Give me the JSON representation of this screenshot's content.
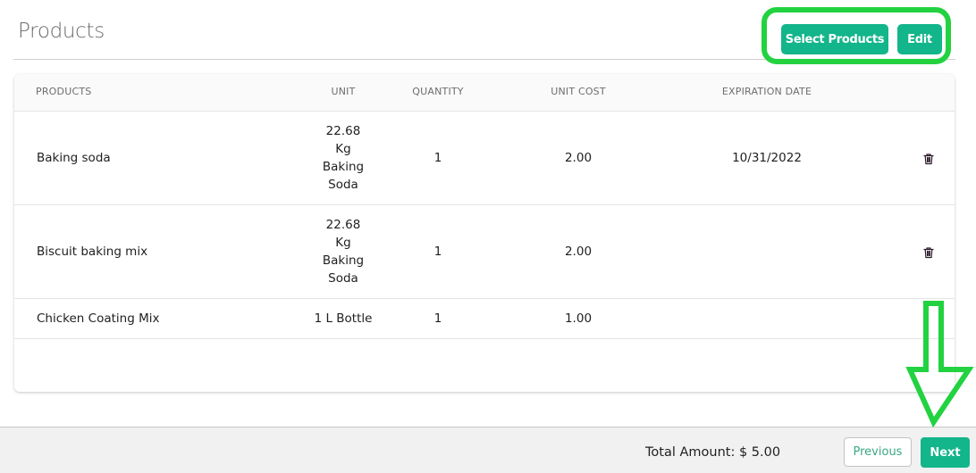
{
  "page": {
    "title": "Products",
    "select_products_label": "Select Products",
    "edit_label": "Edit"
  },
  "table": {
    "columns": [
      "PRODUCTS",
      "UNIT",
      "QUANTITY",
      "UNIT COST",
      "EXPIRATION DATE"
    ],
    "rows": [
      {
        "product": "Baking soda",
        "unit_lines": [
          "22.68",
          "Kg",
          "Baking",
          "Soda"
        ],
        "quantity": "1",
        "unit_cost": "2.00",
        "expiration_date": "10/31/2022"
      },
      {
        "product": "Biscuit baking mix",
        "unit_lines": [
          "22.68",
          "Kg",
          "Baking",
          "Soda"
        ],
        "quantity": "1",
        "unit_cost": "2.00",
        "expiration_date": ""
      },
      {
        "product": "Chicken Coating Mix",
        "unit_lines": [
          "1 L Bottle"
        ],
        "quantity": "1",
        "unit_cost": "1.00",
        "expiration_date": ""
      }
    ],
    "row_action_icon": "trash-icon"
  },
  "footer": {
    "total_amount": "Total Amount: $ 5.00",
    "previous_label": "Previous",
    "next_label": "Next"
  },
  "annotations": {
    "highlight_color": "#22d240",
    "accent_color": "#13b58a"
  }
}
